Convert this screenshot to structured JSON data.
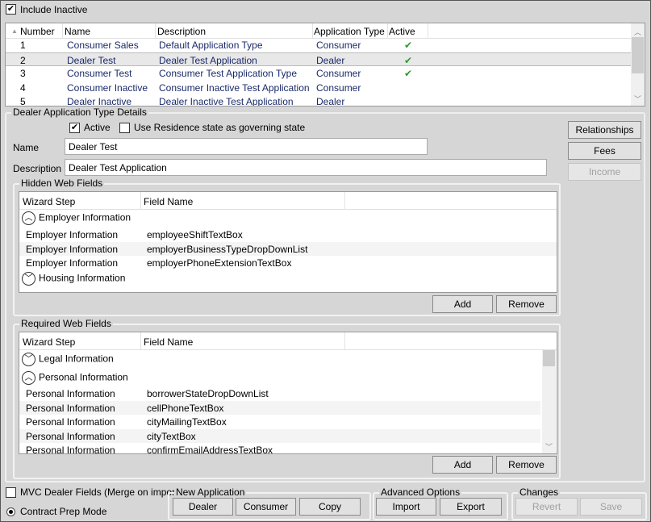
{
  "include_inactive": {
    "label": "Include Inactive",
    "checked": true
  },
  "app_types": {
    "columns": [
      "Number",
      "Name",
      "Description",
      "Application Type",
      "Active"
    ],
    "rows": [
      {
        "number": "1",
        "name": "Consumer Sales",
        "description": "Default Application Type",
        "type": "Consumer",
        "active": true
      },
      {
        "number": "2",
        "name": "Dealer Test",
        "description": "Dealer Test Application",
        "type": "Dealer",
        "active": true,
        "selected": true
      },
      {
        "number": "3",
        "name": "Consumer Test",
        "description": "Consumer Test Application Type",
        "type": "Consumer",
        "active": true
      },
      {
        "number": "4",
        "name": "Consumer Inactive",
        "description": "Consumer Inactive Test Application",
        "type": "Consumer",
        "active": false
      },
      {
        "number": "5",
        "name": "Dealer Inactive",
        "description": "Dealer Inactive Test Application",
        "type": "Dealer",
        "active": false
      }
    ]
  },
  "details": {
    "title": "Dealer Application Type Details",
    "active_label": "Active",
    "active_checked": true,
    "residence_label": "Use Residence state as governing state",
    "residence_checked": false,
    "name_label": "Name",
    "name_value": "Dealer Test",
    "description_label": "Description",
    "description_value": "Dealer Test Application",
    "relationships": "Relationships",
    "fees": "Fees",
    "income": "Income"
  },
  "hidden": {
    "title": "Hidden Web Fields",
    "col_step": "Wizard Step",
    "col_field": "Field Name",
    "group1": "Employer Information",
    "rows": [
      {
        "step": "Employer Information",
        "field": "employeeShiftTextBox"
      },
      {
        "step": "Employer Information",
        "field": "employerBusinessTypeDropDownList"
      },
      {
        "step": "Employer Information",
        "field": "employerPhoneExtensionTextBox"
      }
    ],
    "group2": "Housing Information",
    "add": "Add",
    "remove": "Remove"
  },
  "required": {
    "title": "Required Web Fields",
    "col_step": "Wizard Step",
    "col_field": "Field Name",
    "group1": "Legal Information",
    "group2": "Personal Information",
    "rows": [
      {
        "step": "Personal Information",
        "field": "borrowerStateDropDownList"
      },
      {
        "step": "Personal Information",
        "field": "cellPhoneTextBox"
      },
      {
        "step": "Personal Information",
        "field": "cityMailingTextBox"
      },
      {
        "step": "Personal Information",
        "field": "cityTextBox"
      },
      {
        "step": "Personal Information",
        "field": "confirmEmailAddressTextBox"
      }
    ],
    "add": "Add",
    "remove": "Remove"
  },
  "bottom": {
    "mvc_label": "MVC Dealer Fields (Merge on impor",
    "mvc_checked": false,
    "contract_label": "Contract Prep Mode",
    "contract_selected": true,
    "new_app": {
      "title": "New Application",
      "dealer": "Dealer",
      "consumer": "Consumer",
      "copy": "Copy"
    },
    "advanced": {
      "title": "Advanced Options",
      "import": "Import",
      "export": "Export"
    },
    "changes": {
      "title": "Changes",
      "revert": "Revert",
      "save": "Save"
    }
  },
  "icons": {
    "check": "✔",
    "sort": "▲",
    "up": "⌃",
    "down": "⌄"
  }
}
